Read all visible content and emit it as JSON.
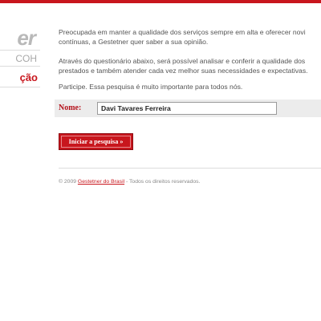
{
  "brand": {
    "word": "er",
    "sub": "COH",
    "section": "ção"
  },
  "intro": {
    "p1_line1": "Preocupada em manter a qualidade dos serviços sempre em alta e oferecer novi",
    "p1_line2": "contínuas, a Gestetner quer saber a sua opinião.",
    "p2_line1": "Através do questionário abaixo, será possível analisar e conferir a qualidade dos",
    "p2_line2": "prestados e também atender cada vez melhor suas necessidades e expectativas.",
    "p3": "Participe. Essa pesquisa é muito importante para todos nós."
  },
  "form": {
    "name_label": "Nome:",
    "name_value": "Davi Tavares Ferreira",
    "start_button": "Iniciar a pesquisa »"
  },
  "footer": {
    "prefix": "© 2009 ",
    "link": "Gestetner do Brasil",
    "suffix": " - Todos os direitos reservados."
  },
  "colors": {
    "accent": "#c8161d",
    "label": "#b5121b",
    "text": "#555555"
  }
}
